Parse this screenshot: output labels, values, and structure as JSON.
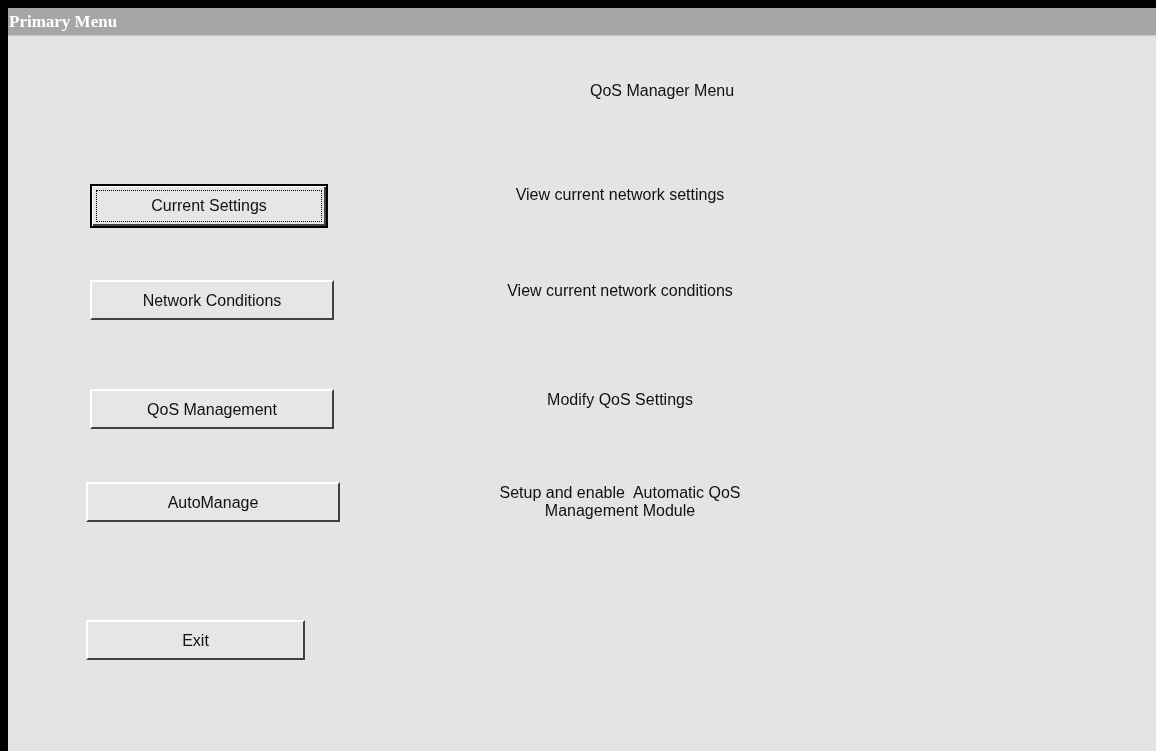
{
  "window": {
    "title": "Primary Menu"
  },
  "heading": "QoS Manager Menu",
  "menu": [
    {
      "button": "Current Settings",
      "focused": true,
      "description": "View current network settings"
    },
    {
      "button": "Network Conditions",
      "focused": false,
      "description": "View current network conditions"
    },
    {
      "button": "QoS Management",
      "focused": false,
      "description": "Modify QoS Settings"
    },
    {
      "button": "AutoManage",
      "focused": false,
      "description": "Setup and enable  Automatic QoS\nManagement Module"
    },
    {
      "button": "Exit",
      "focused": false
    }
  ]
}
